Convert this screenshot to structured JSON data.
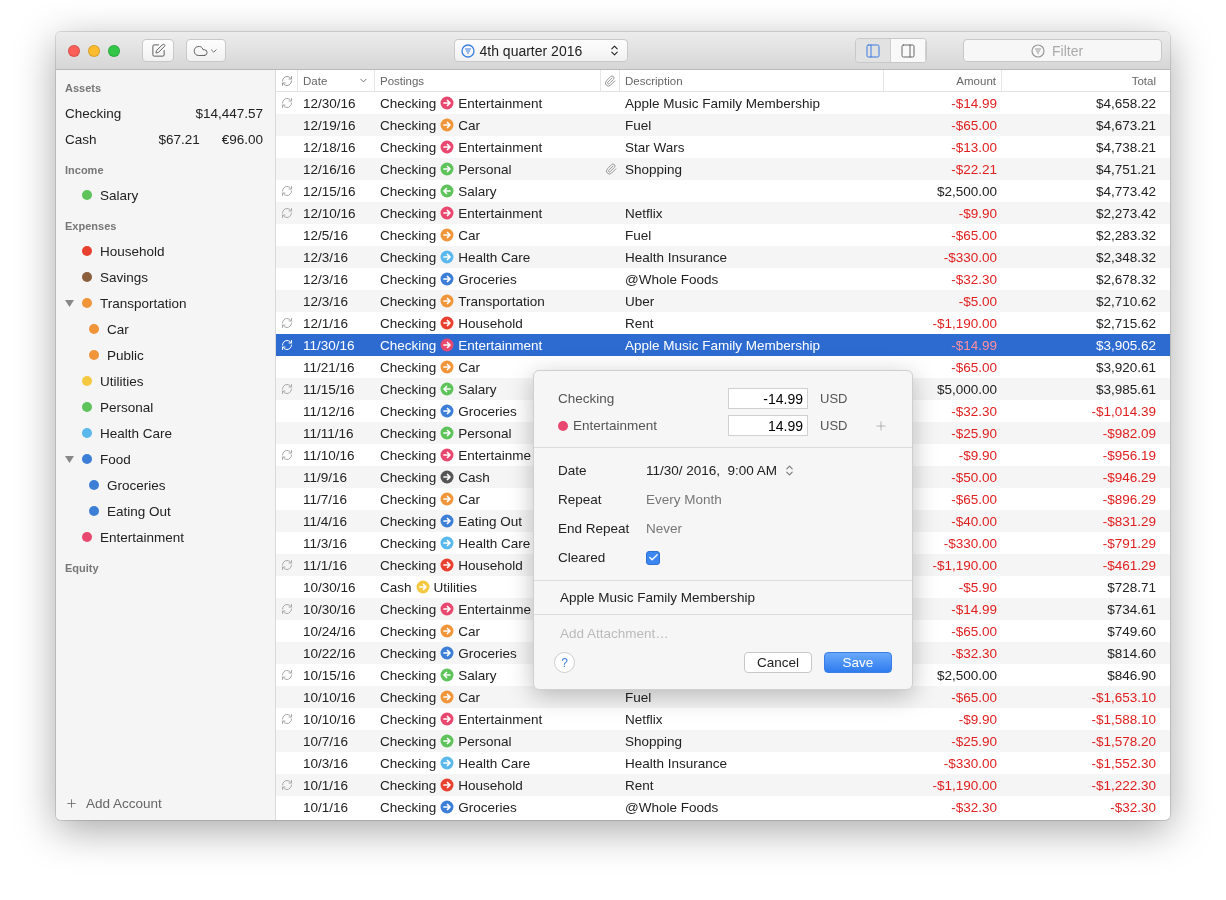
{
  "toolbar": {
    "period": "4th quarter 2016",
    "view_buttons": [
      {
        "selected": true
      },
      {
        "selected": false
      }
    ],
    "filter": {
      "placeholder": "Filter"
    }
  },
  "sidebar": {
    "sections": [
      {
        "title": "Assets",
        "items": [
          {
            "name": "Checking",
            "balances": [
              "$14,447.57"
            ]
          },
          {
            "name": "Cash",
            "balances": [
              "$67.21",
              "€96.00"
            ]
          }
        ]
      },
      {
        "title": "Income",
        "items": [
          {
            "name": "Salary",
            "color": "#5ec35a"
          }
        ]
      },
      {
        "title": "Expenses",
        "items": [
          {
            "name": "Household",
            "color": "#e8412f"
          },
          {
            "name": "Savings",
            "color": "#8b5e3c"
          },
          {
            "name": "Transportation",
            "color": "#f0953a",
            "expanded": true,
            "children": [
              {
                "name": "Car",
                "color": "#f0953a"
              },
              {
                "name": "Public",
                "color": "#f0953a"
              }
            ]
          },
          {
            "name": "Utilities",
            "color": "#f5c842"
          },
          {
            "name": "Personal",
            "color": "#5ec35a"
          },
          {
            "name": "Health Care",
            "color": "#5ab8ec"
          },
          {
            "name": "Food",
            "color": "#3d7fd6",
            "expanded": true,
            "children": [
              {
                "name": "Groceries",
                "color": "#3d7fd6"
              },
              {
                "name": "Eating Out",
                "color": "#3d7fd6"
              }
            ]
          },
          {
            "name": "Entertainment",
            "color": "#e8486f"
          }
        ]
      },
      {
        "title": "Equity"
      }
    ],
    "add_account": "Add Account"
  },
  "table": {
    "columns": [
      "Date",
      "Postings",
      "Description",
      "Amount",
      "Total"
    ],
    "rows": [
      {
        "recurring": true,
        "date": "12/30/16",
        "from": "Checking",
        "to": "Entertainment",
        "color": "#e8486f",
        "incoming": false,
        "attachment": false,
        "description": "Apple Music Family Membership",
        "amount": "-$14.99",
        "amount_negative": true,
        "total": "$4,658.22",
        "total_negative": false,
        "selected": false
      },
      {
        "recurring": false,
        "date": "12/19/16",
        "from": "Checking",
        "to": "Car",
        "color": "#f0953a",
        "incoming": false,
        "attachment": false,
        "description": "Fuel",
        "amount": "-$65.00",
        "amount_negative": true,
        "total": "$4,673.21",
        "total_negative": false,
        "selected": false
      },
      {
        "recurring": false,
        "date": "12/18/16",
        "from": "Checking",
        "to": "Entertainment",
        "color": "#e8486f",
        "incoming": false,
        "attachment": false,
        "description": "Star Wars",
        "amount": "-$13.00",
        "amount_negative": true,
        "total": "$4,738.21",
        "total_negative": false,
        "selected": false
      },
      {
        "recurring": false,
        "date": "12/16/16",
        "from": "Checking",
        "to": "Personal",
        "color": "#5ec35a",
        "incoming": false,
        "attachment": true,
        "description": "Shopping",
        "amount": "-$22.21",
        "amount_negative": true,
        "total": "$4,751.21",
        "total_negative": false,
        "selected": false
      },
      {
        "recurring": true,
        "date": "12/15/16",
        "from": "Checking",
        "to": "Salary",
        "color": "#5ec35a",
        "incoming": true,
        "attachment": false,
        "amount": "$2,500.00",
        "amount_negative": false,
        "total": "$4,773.42",
        "total_negative": false,
        "selected": false
      },
      {
        "recurring": true,
        "date": "12/10/16",
        "from": "Checking",
        "to": "Entertainment",
        "color": "#e8486f",
        "incoming": false,
        "attachment": false,
        "description": "Netflix",
        "amount": "-$9.90",
        "amount_negative": true,
        "total": "$2,273.42",
        "total_negative": false,
        "selected": false
      },
      {
        "recurring": false,
        "date": "12/5/16",
        "from": "Checking",
        "to": "Car",
        "color": "#f0953a",
        "incoming": false,
        "attachment": false,
        "description": "Fuel",
        "amount": "-$65.00",
        "amount_negative": true,
        "total": "$2,283.32",
        "total_negative": false,
        "selected": false
      },
      {
        "recurring": false,
        "date": "12/3/16",
        "from": "Checking",
        "to": "Health Care",
        "color": "#5ab8ec",
        "incoming": false,
        "attachment": false,
        "description": "Health Insurance",
        "amount": "-$330.00",
        "amount_negative": true,
        "total": "$2,348.32",
        "total_negative": false,
        "selected": false
      },
      {
        "recurring": false,
        "date": "12/3/16",
        "from": "Checking",
        "to": "Groceries",
        "color": "#3d7fd6",
        "incoming": false,
        "attachment": false,
        "description": "@Whole Foods",
        "amount": "-$32.30",
        "amount_negative": true,
        "total": "$2,678.32",
        "total_negative": false,
        "selected": false
      },
      {
        "recurring": false,
        "date": "12/3/16",
        "from": "Checking",
        "to": "Transportation",
        "color": "#f0953a",
        "incoming": false,
        "attachment": false,
        "description": "Uber",
        "amount": "-$5.00",
        "amount_negative": true,
        "total": "$2,710.62",
        "total_negative": false,
        "selected": false
      },
      {
        "recurring": true,
        "date": "12/1/16",
        "from": "Checking",
        "to": "Household",
        "color": "#e8412f",
        "incoming": false,
        "attachment": false,
        "description": "Rent",
        "amount": "-$1,190.00",
        "amount_negative": true,
        "total": "$2,715.62",
        "total_negative": false,
        "selected": false
      },
      {
        "recurring": true,
        "date": "11/30/16",
        "from": "Checking",
        "to": "Entertainment",
        "color": "#e8486f",
        "incoming": false,
        "attachment": false,
        "description": "Apple Music Family Membership",
        "amount": "-$14.99",
        "amount_negative": true,
        "total": "$3,905.62",
        "total_negative": false,
        "selected": true
      },
      {
        "recurring": false,
        "date": "11/21/16",
        "from": "Checking",
        "to": "Car",
        "color": "#f0953a",
        "incoming": false,
        "attachment": false,
        "amount": "-$65.00",
        "amount_negative": true,
        "total": "$3,920.61",
        "total_negative": false,
        "selected": false
      },
      {
        "recurring": true,
        "date": "11/15/16",
        "from": "Checking",
        "to": "Salary",
        "color": "#5ec35a",
        "incoming": true,
        "attachment": false,
        "amount": "$5,000.00",
        "amount_negative": false,
        "total": "$3,985.61",
        "total_negative": false,
        "selected": false
      },
      {
        "recurring": false,
        "date": "11/12/16",
        "from": "Checking",
        "to": "Groceries",
        "color": "#3d7fd6",
        "incoming": false,
        "attachment": false,
        "amount": "-$32.30",
        "amount_negative": true,
        "total": "-$1,014.39",
        "total_negative": true,
        "selected": false
      },
      {
        "recurring": false,
        "date": "11/11/16",
        "from": "Checking",
        "to": "Personal",
        "color": "#5ec35a",
        "incoming": false,
        "attachment": false,
        "amount": "-$25.90",
        "amount_negative": true,
        "total": "-$982.09",
        "total_negative": true,
        "selected": false
      },
      {
        "recurring": true,
        "date": "11/10/16",
        "from": "Checking",
        "to": "Entertainme",
        "color": "#e8486f",
        "incoming": false,
        "attachment": false,
        "amount": "-$9.90",
        "amount_negative": true,
        "total": "-$956.19",
        "total_negative": true,
        "selected": false
      },
      {
        "recurring": false,
        "date": "11/9/16",
        "from": "Checking",
        "to": "Cash",
        "color": "#555555",
        "incoming": false,
        "attachment": false,
        "amount": "-$50.00",
        "amount_negative": true,
        "total": "-$946.29",
        "total_negative": true,
        "selected": false
      },
      {
        "recurring": false,
        "date": "11/7/16",
        "from": "Checking",
        "to": "Car",
        "color": "#f0953a",
        "incoming": false,
        "attachment": false,
        "amount": "-$65.00",
        "amount_negative": true,
        "total": "-$896.29",
        "total_negative": true,
        "selected": false
      },
      {
        "recurring": false,
        "date": "11/4/16",
        "from": "Checking",
        "to": "Eating Out",
        "color": "#3d7fd6",
        "incoming": false,
        "attachment": false,
        "amount": "-$40.00",
        "amount_negative": true,
        "total": "-$831.29",
        "total_negative": true,
        "selected": false
      },
      {
        "recurring": false,
        "date": "11/3/16",
        "from": "Checking",
        "to": "Health Care",
        "color": "#5ab8ec",
        "incoming": false,
        "attachment": false,
        "amount": "-$330.00",
        "amount_negative": true,
        "total": "-$791.29",
        "total_negative": true,
        "selected": false
      },
      {
        "recurring": true,
        "date": "11/1/16",
        "from": "Checking",
        "to": "Household",
        "color": "#e8412f",
        "incoming": false,
        "attachment": false,
        "amount": "-$1,190.00",
        "amount_negative": true,
        "total": "-$461.29",
        "total_negative": true,
        "selected": false
      },
      {
        "recurring": false,
        "date": "10/30/16",
        "from": "Cash",
        "to": "Utilities",
        "color": "#f5c842",
        "incoming": false,
        "attachment": false,
        "amount": "-$5.90",
        "amount_negative": true,
        "total": "$728.71",
        "total_negative": false,
        "selected": false
      },
      {
        "recurring": true,
        "date": "10/30/16",
        "from": "Checking",
        "to": "Entertainme",
        "color": "#e8486f",
        "incoming": false,
        "attachment": false,
        "amount": "-$14.99",
        "amount_negative": true,
        "total": "$734.61",
        "total_negative": false,
        "selected": false
      },
      {
        "recurring": false,
        "date": "10/24/16",
        "from": "Checking",
        "to": "Car",
        "color": "#f0953a",
        "incoming": false,
        "attachment": false,
        "amount": "-$65.00",
        "amount_negative": true,
        "total": "$749.60",
        "total_negative": false,
        "selected": false
      },
      {
        "recurring": false,
        "date": "10/22/16",
        "from": "Checking",
        "to": "Groceries",
        "color": "#3d7fd6",
        "incoming": false,
        "attachment": false,
        "amount": "-$32.30",
        "amount_negative": true,
        "total": "$814.60",
        "total_negative": false,
        "selected": false
      },
      {
        "recurring": true,
        "date": "10/15/16",
        "from": "Checking",
        "to": "Salary",
        "color": "#5ec35a",
        "incoming": true,
        "attachment": false,
        "amount": "$2,500.00",
        "amount_negative": false,
        "total": "$846.90",
        "total_negative": false,
        "selected": false
      },
      {
        "recurring": false,
        "date": "10/10/16",
        "from": "Checking",
        "to": "Car",
        "color": "#f0953a",
        "incoming": false,
        "attachment": false,
        "description": "Fuel",
        "amount": "-$65.00",
        "amount_negative": true,
        "total": "-$1,653.10",
        "total_negative": true,
        "selected": false
      },
      {
        "recurring": true,
        "date": "10/10/16",
        "from": "Checking",
        "to": "Entertainment",
        "color": "#e8486f",
        "incoming": false,
        "attachment": false,
        "description": "Netflix",
        "amount": "-$9.90",
        "amount_negative": true,
        "total": "-$1,588.10",
        "total_negative": true,
        "selected": false
      },
      {
        "recurring": false,
        "date": "10/7/16",
        "from": "Checking",
        "to": "Personal",
        "color": "#5ec35a",
        "incoming": false,
        "attachment": false,
        "description": "Shopping",
        "amount": "-$25.90",
        "amount_negative": true,
        "total": "-$1,578.20",
        "total_negative": true,
        "selected": false
      },
      {
        "recurring": false,
        "date": "10/3/16",
        "from": "Checking",
        "to": "Health Care",
        "color": "#5ab8ec",
        "incoming": false,
        "attachment": false,
        "description": "Health Insurance",
        "amount": "-$330.00",
        "amount_negative": true,
        "total": "-$1,552.30",
        "total_negative": true,
        "selected": false
      },
      {
        "recurring": true,
        "date": "10/1/16",
        "from": "Checking",
        "to": "Household",
        "color": "#e8412f",
        "incoming": false,
        "attachment": false,
        "description": "Rent",
        "amount": "-$1,190.00",
        "amount_negative": true,
        "total": "-$1,222.30",
        "total_negative": true,
        "selected": false
      },
      {
        "recurring": false,
        "date": "10/1/16",
        "from": "Checking",
        "to": "Groceries",
        "color": "#3d7fd6",
        "incoming": false,
        "attachment": false,
        "description": "@Whole Foods",
        "amount": "-$32.30",
        "amount_negative": true,
        "total": "-$32.30",
        "total_negative": true,
        "selected": false
      }
    ]
  },
  "popover": {
    "splits": [
      {
        "account": "Checking",
        "amount": "-14.99",
        "currency": "USD"
      },
      {
        "account": "Entertainment",
        "color": "#e8486f",
        "amount": "14.99",
        "currency": "USD"
      }
    ],
    "details": [
      {
        "kind": "datetime",
        "label": "Date",
        "value": "11/30/ 2016,  9:00 AM"
      },
      {
        "kind": "choice",
        "label": "Repeat",
        "value": "Every Month"
      },
      {
        "kind": "choice",
        "label": "End Repeat",
        "value": "Never"
      },
      {
        "kind": "checkbox",
        "label": "Cleared",
        "checked": true
      }
    ],
    "memo": "Apple Music Family Membership",
    "attachment_placeholder": "Add Attachment…",
    "help": "?",
    "buttons": [
      "Cancel",
      "Save"
    ]
  }
}
